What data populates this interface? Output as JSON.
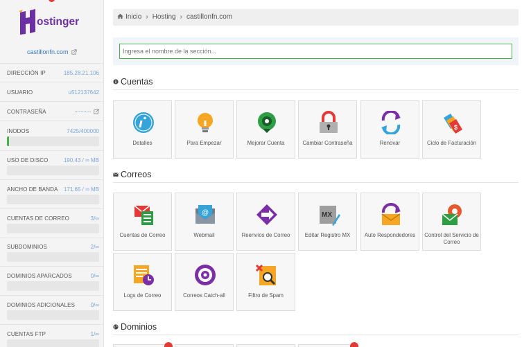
{
  "sidebar": {
    "logo_text": "Hostinger",
    "domain": "castillonfn.com",
    "rows": [
      {
        "label": "DIRECCIÓN IP",
        "value": "185.28.21.106"
      },
      {
        "label": "USUARIO",
        "value": "u512137642"
      },
      {
        "label": "CONTRASEÑA",
        "value": "···········"
      },
      {
        "label": "INODOS",
        "value": "7425/400000"
      },
      {
        "label": "USO DE DISCO",
        "value": "190.43 / ∞ MB"
      },
      {
        "label": "ANCHO DE BANDA",
        "value": "171.65 / ∞ MB"
      },
      {
        "label": "CUENTAS DE CORREO",
        "value": "3/∞"
      },
      {
        "label": "SUBDOMINIOS",
        "value": "2/∞"
      },
      {
        "label": "DOMINIOS APARCADOS",
        "value": "0/∞"
      },
      {
        "label": "DOMINIOS ADICIONALES",
        "value": "0/∞"
      },
      {
        "label": "CUENTAS FTP",
        "value": "1/∞"
      }
    ],
    "inodes_fraction": 0.0186
  },
  "breadcrumb": [
    "Inicio",
    "Hosting",
    "castillonfn.com"
  ],
  "search": {
    "placeholder": "Ingresa el nombre de la sección...",
    "value": ""
  },
  "sections": {
    "cuentas": {
      "title": "Cuentas",
      "tiles": [
        {
          "label": "Detalles",
          "icon": "info-icon"
        },
        {
          "label": "Para Empezar",
          "icon": "lightbulb-icon"
        },
        {
          "label": "Mejorar Cuenta",
          "icon": "upgrade-icon"
        },
        {
          "label": "Cambiar Contraseña",
          "icon": "lock-icon"
        },
        {
          "label": "Renovar",
          "icon": "renew-icon"
        },
        {
          "label": "Ciclo de Facturación",
          "icon": "billing-tags-icon"
        }
      ]
    },
    "correos": {
      "title": "Correos",
      "tiles": [
        {
          "label": "Cuentas de Correo",
          "icon": "email-accounts-icon"
        },
        {
          "label": "Webmail",
          "icon": "webmail-icon"
        },
        {
          "label": "Reenvíos de Correo",
          "icon": "forwarders-icon"
        },
        {
          "label": "Editar Registro MX",
          "icon": "mx-record-icon"
        },
        {
          "label": "Auto Respondedores",
          "icon": "autoresponder-icon"
        },
        {
          "label": "Control del Servicio de Correo",
          "icon": "mail-service-icon"
        },
        {
          "label": "Logs de Correo",
          "icon": "mail-logs-icon"
        },
        {
          "label": "Correos Catch-all",
          "icon": "catch-all-icon"
        },
        {
          "label": "Filtro de Spam",
          "icon": "spam-filter-icon"
        }
      ]
    },
    "dominios": {
      "title": "Dominios"
    }
  },
  "colors": {
    "accent_blue": "#3a78c3",
    "green": "#4caf50",
    "purple": "#6b2fa6",
    "orange": "#f5a623",
    "red": "#e53935"
  }
}
